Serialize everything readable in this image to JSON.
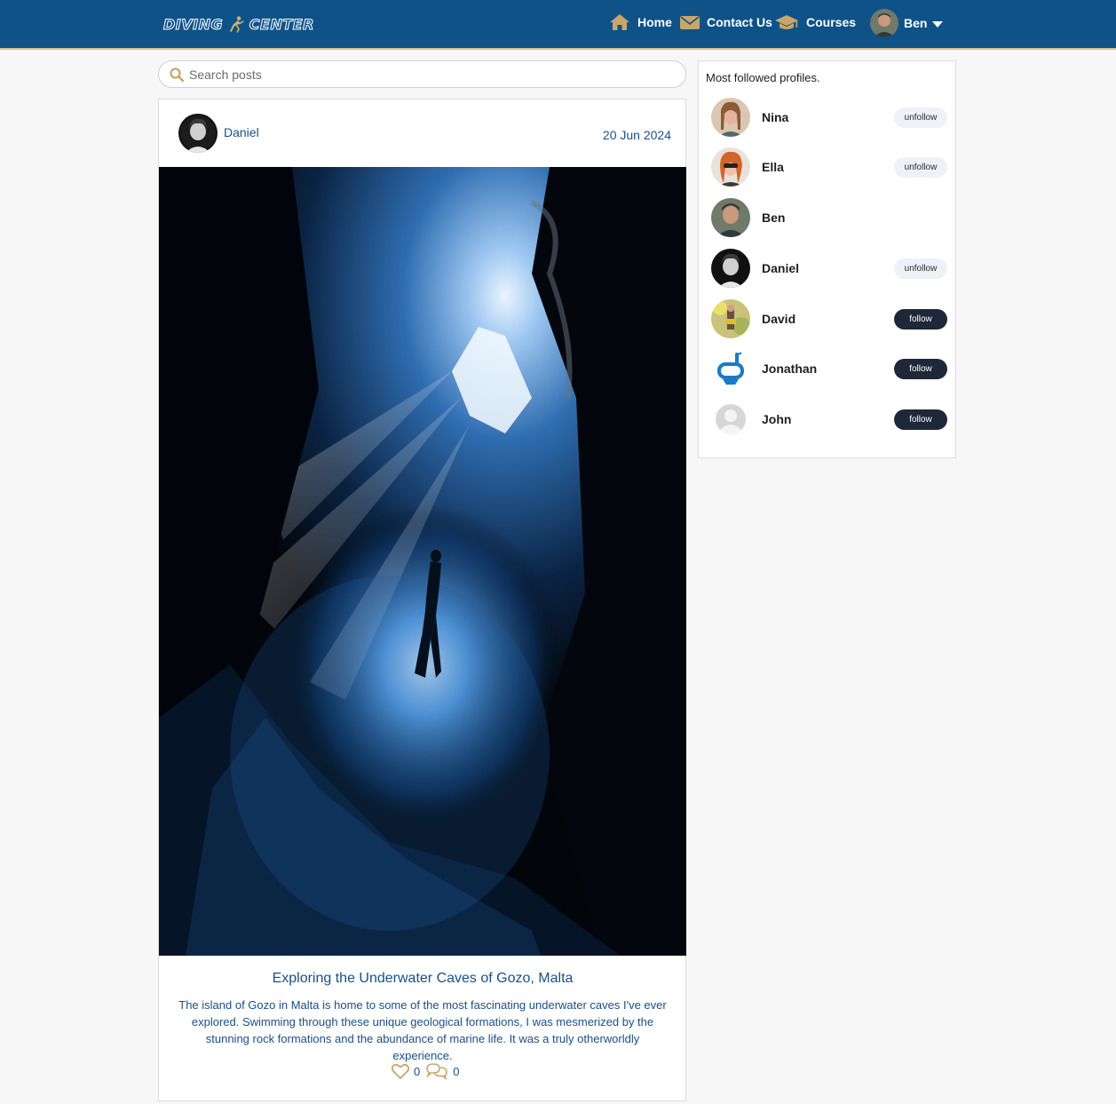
{
  "header": {
    "logo_text_left": "DIVING",
    "logo_text_right": "CENTER",
    "nav": [
      {
        "label": "Home",
        "icon": "home-icon"
      },
      {
        "label": "Contact Us",
        "icon": "envelope-icon"
      },
      {
        "label": "Courses",
        "icon": "graduation-cap-icon"
      }
    ],
    "user": {
      "name": "Ben",
      "icon": "caret-down-icon"
    }
  },
  "search": {
    "placeholder": "Search posts",
    "value": ""
  },
  "post": {
    "author": "Daniel",
    "date": "20 Jun 2024",
    "title": "Exploring the Underwater Caves of Gozo, Malta",
    "body": "The island of Gozo in Malta is home to some of the most fascinating underwater caves I've ever explored. Swimming through these unique geological formations, I was mesmerized by the stunning rock formations and the abundance of marine life. It was a truly otherworldly experience.",
    "likes": "0",
    "comments": "0"
  },
  "sidebar": {
    "title": "Most followed profiles.",
    "profiles": [
      {
        "name": "Nina",
        "button": "unfollow"
      },
      {
        "name": "Ella",
        "button": "unfollow"
      },
      {
        "name": "Ben",
        "button": ""
      },
      {
        "name": "Daniel",
        "button": "unfollow"
      },
      {
        "name": "David",
        "button": "follow"
      },
      {
        "name": "Jonathan",
        "button": "follow"
      },
      {
        "name": "John",
        "button": "follow"
      }
    ]
  },
  "colors": {
    "header": "#0f5288",
    "accent": "#c8a56a",
    "follow_button": "#1e2838",
    "text": "#1a4f86"
  }
}
